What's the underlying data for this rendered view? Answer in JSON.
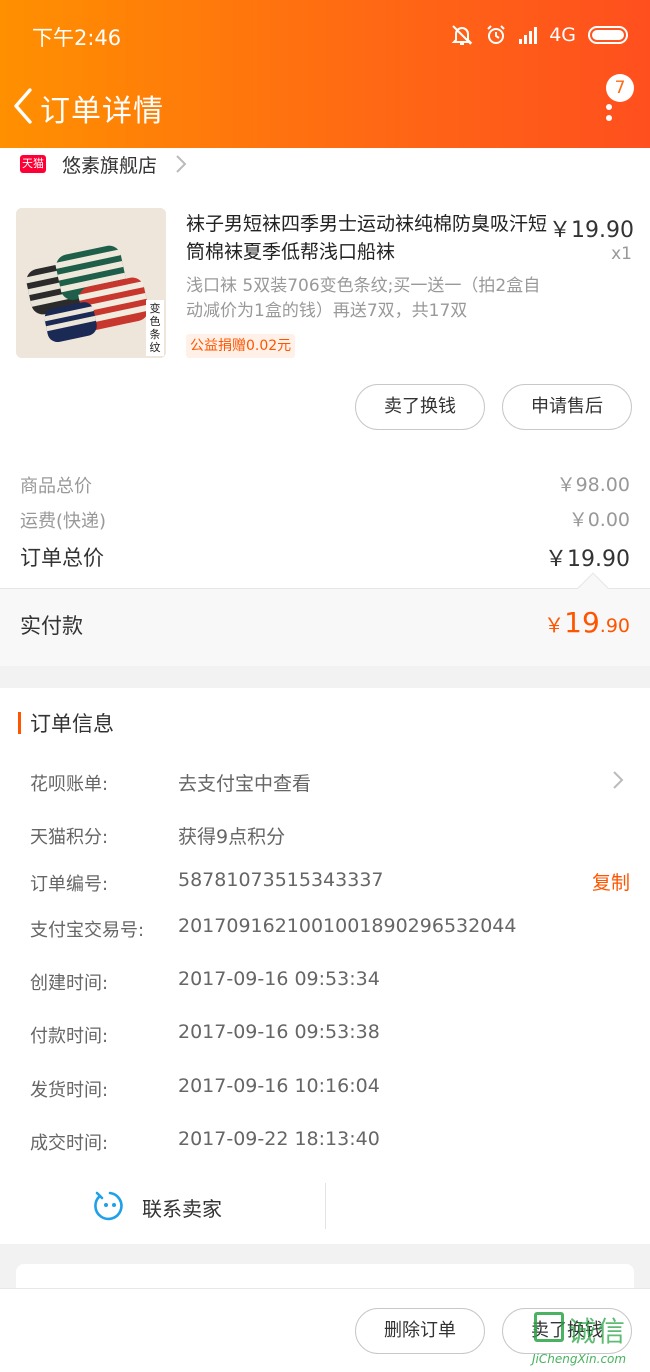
{
  "status_bar": {
    "time": "下午2:46",
    "network": "4G"
  },
  "header": {
    "title": "订单详情",
    "badge_count": "7"
  },
  "shop": {
    "badge": "天猫",
    "name": "悠素旗舰店"
  },
  "product": {
    "title": "袜子男短袜四季男士运动袜纯棉防臭吸汗短筒棉袜夏季低帮浅口船袜",
    "price": "￥19.90",
    "quantity": "x1",
    "sku": "浅口袜 5双装706变色条纹;买一送一（拍2盒自动减价为1盒的钱）再送7双，共17双",
    "thumb_tag": "变色条纹",
    "charity": "公益捐赠0.02元"
  },
  "actions": {
    "sell_exchange": "卖了换钱",
    "after_sale": "申请售后"
  },
  "summary": {
    "goods_total_label": "商品总价",
    "goods_total_value": "￥98.00",
    "shipping_label": "运费(快递)",
    "shipping_value": "￥0.00",
    "order_total_label": "订单总价",
    "order_total_value": "￥19.90",
    "paid_label": "实付款",
    "paid_currency": "￥",
    "paid_int": "19",
    "paid_dec": ".90"
  },
  "order_info": {
    "title": "订单信息",
    "rows": [
      {
        "label": "花呗账单:",
        "value": "去支付宝中查看"
      },
      {
        "label": "天猫积分:",
        "value": "获得9点积分"
      },
      {
        "label": "订单编号:",
        "value": "58781073515343337"
      },
      {
        "label": "支付宝交易号:",
        "value": "2017091621001001890296532044"
      },
      {
        "label": "创建时间:",
        "value": "2017-09-16 09:53:34"
      },
      {
        "label": "付款时间:",
        "value": "2017-09-16 09:53:38"
      },
      {
        "label": "发货时间:",
        "value": "2017-09-16 10:16:04"
      },
      {
        "label": "成交时间:",
        "value": "2017-09-22 18:13:40"
      }
    ],
    "copy_label": "复制",
    "contact_seller": "联系卖家"
  },
  "bottom_bar": {
    "delete_order": "删除订单",
    "sell_exchange": "卖了换钱"
  },
  "watermark": {
    "chars": "诚信",
    "url": "JiChengXin.com"
  },
  "colors": {
    "header_start": "#ff9000",
    "header_end": "#ff4f1e",
    "accent": "#ff5500",
    "tmall": "#ff0036"
  }
}
